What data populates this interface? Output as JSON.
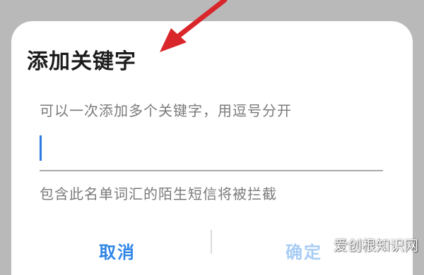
{
  "dialog": {
    "title": "添加关键字",
    "hint": "可以一次添加多个关键字，用逗号分开",
    "input_value": "",
    "note": "包含此名单词汇的陌生短信将被拦截",
    "cancel_label": "取消",
    "confirm_label": "确定"
  },
  "watermark": {
    "text": "爱创根知识网"
  },
  "colors": {
    "accent": "#2f86e6",
    "accent_disabled": "#a8cdf5",
    "annotation_arrow": "#d9262b",
    "overlay": "#b9b9b9"
  }
}
